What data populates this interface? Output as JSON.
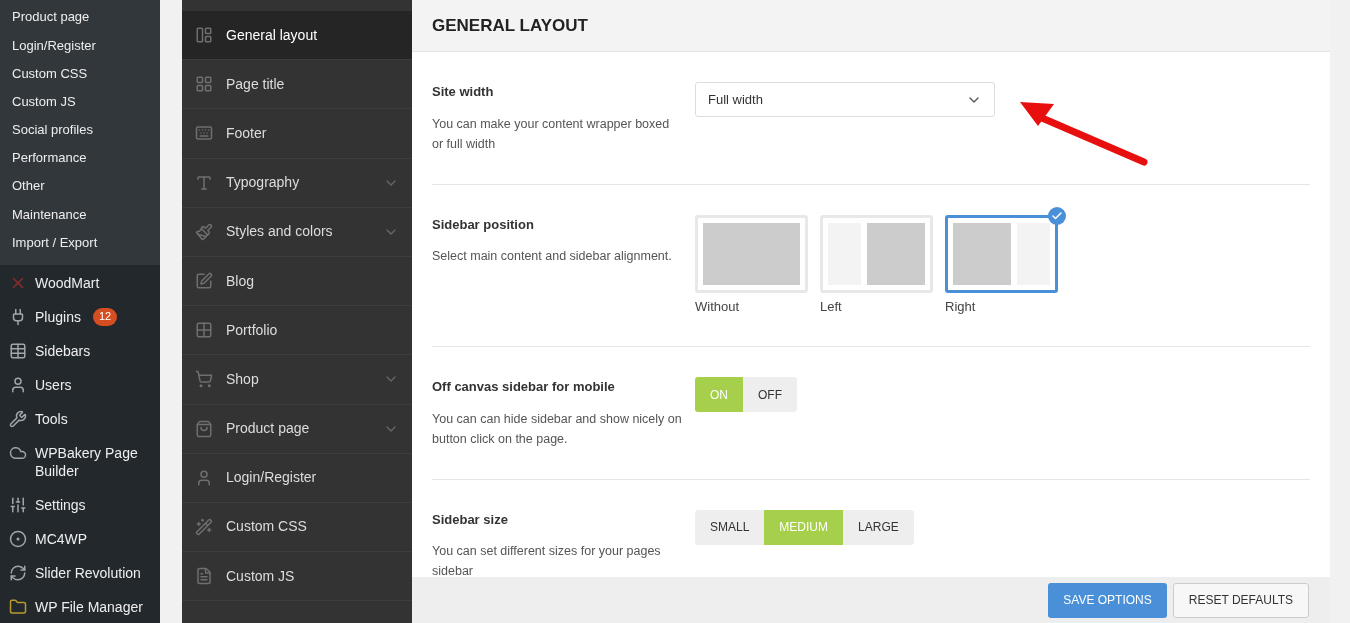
{
  "admin_menu": {
    "submenu": [
      {
        "label": "Product page"
      },
      {
        "label": "Login/Register"
      },
      {
        "label": "Custom CSS"
      },
      {
        "label": "Custom JS"
      },
      {
        "label": "Social profiles"
      },
      {
        "label": "Performance"
      },
      {
        "label": "Other"
      },
      {
        "label": "Maintenance"
      },
      {
        "label": "Import / Export"
      }
    ],
    "items": [
      {
        "label": "WoodMart"
      },
      {
        "label": "Plugins",
        "badge": "12"
      },
      {
        "label": "Sidebars"
      },
      {
        "label": "Users"
      },
      {
        "label": "Tools"
      },
      {
        "label": "WPBakery Page Builder"
      },
      {
        "label": "Settings"
      },
      {
        "label": "MC4WP"
      },
      {
        "label": "Slider Revolution"
      },
      {
        "label": "WP File Manager"
      }
    ]
  },
  "options_nav": [
    {
      "label": "General layout",
      "selected": true,
      "expandable": false
    },
    {
      "label": "Page title",
      "selected": false,
      "expandable": false
    },
    {
      "label": "Footer",
      "selected": false,
      "expandable": false
    },
    {
      "label": "Typography",
      "selected": false,
      "expandable": true
    },
    {
      "label": "Styles and colors",
      "selected": false,
      "expandable": true
    },
    {
      "label": "Blog",
      "selected": false,
      "expandable": false
    },
    {
      "label": "Portfolio",
      "selected": false,
      "expandable": false
    },
    {
      "label": "Shop",
      "selected": false,
      "expandable": true
    },
    {
      "label": "Product page",
      "selected": false,
      "expandable": true
    },
    {
      "label": "Login/Register",
      "selected": false,
      "expandable": false
    },
    {
      "label": "Custom CSS",
      "selected": false,
      "expandable": false
    },
    {
      "label": "Custom JS",
      "selected": false,
      "expandable": false
    }
  ],
  "panel": {
    "title": "GENERAL LAYOUT",
    "settings": [
      {
        "kind": "select",
        "title": "Site width",
        "description": "You can make your content wrapper boxed or full width",
        "value": "Full width"
      },
      {
        "kind": "layouts",
        "title": "Sidebar position",
        "description": "Select main content and sidebar alignment.",
        "options": [
          {
            "label": "Without",
            "selected": false
          },
          {
            "label": "Left",
            "selected": false
          },
          {
            "label": "Right",
            "selected": true
          }
        ]
      },
      {
        "kind": "buttons",
        "title": "Off canvas sidebar for mobile",
        "description": "You can can hide sidebar and show nicely on button click on the page.",
        "options": [
          {
            "label": "ON",
            "selected": true
          },
          {
            "label": "OFF",
            "selected": false
          }
        ]
      },
      {
        "kind": "buttons",
        "title": "Sidebar size",
        "description": "You can set different sizes for your pages sidebar",
        "options": [
          {
            "label": "SMALL",
            "selected": false
          },
          {
            "label": "MEDIUM",
            "selected": true
          },
          {
            "label": "LARGE",
            "selected": false
          }
        ]
      }
    ],
    "buttons": [
      {
        "label": "SAVE OPTIONS",
        "kind": "primary"
      },
      {
        "label": "RESET DEFAULTS",
        "kind": "secondary"
      }
    ]
  }
}
